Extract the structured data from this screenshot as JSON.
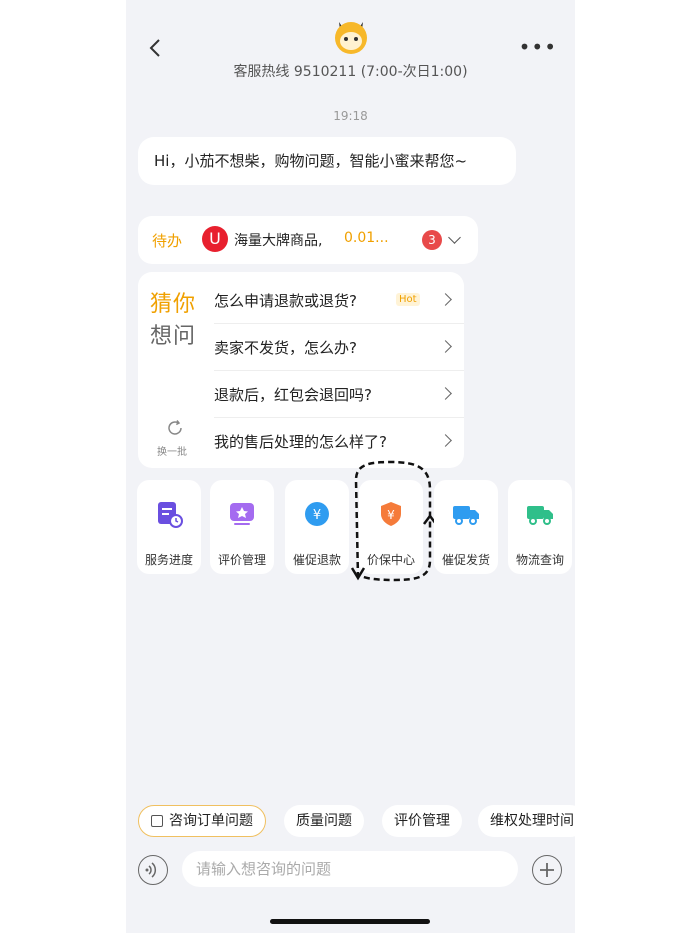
{
  "header": {
    "hotline": "客服热线 9510211 (7:00-次日1:00)",
    "back_icon": "chevron-left-icon",
    "more_icon": "more-dots-icon",
    "avatar_icon": "mascot-icon"
  },
  "chat": {
    "time": "19:18",
    "greeting": "Hi，小茄不想柴，购物问题，智能小蜜来帮您~"
  },
  "todo": {
    "label": "待办",
    "shop_logo": "U",
    "title": "海量大牌商品,",
    "price": "0.01...",
    "badge": "3"
  },
  "faq": {
    "guess_line1": "猜你",
    "guess_line2": "想问",
    "refresh_label": "换一批",
    "hot_tag": "Hot",
    "questions": [
      "怎么申请退款或退货?",
      "卖家不发货，怎么办?",
      "退款后，红包会退回吗?",
      "我的售后处理的怎么样了?"
    ]
  },
  "tools": [
    {
      "label": "服务进度",
      "icon": "progress-doc-icon",
      "color": "#6a4fe0"
    },
    {
      "label": "评价管理",
      "icon": "review-icon",
      "color": "#a46bf0"
    },
    {
      "label": "催促退款",
      "icon": "refund-icon",
      "color": "#2f9cf0"
    },
    {
      "label": "价保中心",
      "icon": "price-shield-icon",
      "color": "#f57b3a"
    },
    {
      "label": "催促发货",
      "icon": "truck-icon",
      "color": "#2f9cf0"
    },
    {
      "label": "物流查询",
      "icon": "logistics-truck-icon",
      "color": "#2fbf8a"
    }
  ],
  "chips": [
    "咨询订单问题",
    "质量问题",
    "评价管理",
    "维权处理时间"
  ],
  "input": {
    "placeholder": "请输入想咨询的问题"
  },
  "colors": {
    "accent": "#f0a000",
    "background": "#f2f3f7"
  }
}
